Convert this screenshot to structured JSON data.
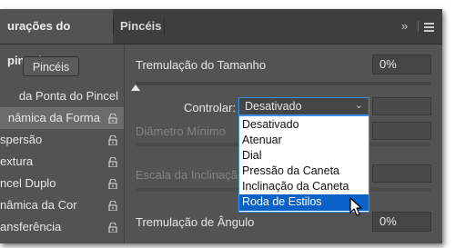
{
  "tabs": [
    {
      "label": "urações do pincel",
      "active": true
    },
    {
      "label": "Pincéis",
      "active": false
    }
  ],
  "tabbar": {
    "collapse_glyph": "»",
    "menu_icon": "hamburger-menu-icon"
  },
  "sidebar": {
    "brushes_button": "Pincéis",
    "items": [
      {
        "label": "da Ponta do Pincel",
        "lock": false,
        "selected": false
      },
      {
        "label": "nâmica da Forma",
        "lock": true,
        "selected": true
      },
      {
        "label": "spersão",
        "lock": true,
        "selected": false
      },
      {
        "label": "extura",
        "lock": true,
        "selected": false
      },
      {
        "label": "ncel Duplo",
        "lock": true,
        "selected": false
      },
      {
        "label": "nâmica da Cor",
        "lock": true,
        "selected": false
      },
      {
        "label": "ansferência",
        "lock": true,
        "selected": false
      }
    ]
  },
  "main": {
    "size_jitter": {
      "label": "Tremulação do Tamanho",
      "value": "0%",
      "slider_level": 0.0
    },
    "control": {
      "label": "Controlar:",
      "selected": "Desativado"
    },
    "min_diameter": {
      "label": "Diâmetro Mínimo"
    },
    "tilt_scale": {
      "label": "Escala da Inclinação"
    },
    "angle_jitter": {
      "label": "Tremulação de Ângulo",
      "value": "0%"
    }
  },
  "dropdown": {
    "options": [
      "Desativado",
      "Atenuar",
      "Dial",
      "Pressão da Caneta",
      "Inclinação da Caneta",
      "Roda de Estilos"
    ],
    "highlighted": "Roda de Estilos"
  },
  "colors": {
    "panel_bg": "#535353",
    "tab_bar": "#3e3e3e",
    "selection": "#0a62c9",
    "focus_border": "#3a8ee6"
  }
}
